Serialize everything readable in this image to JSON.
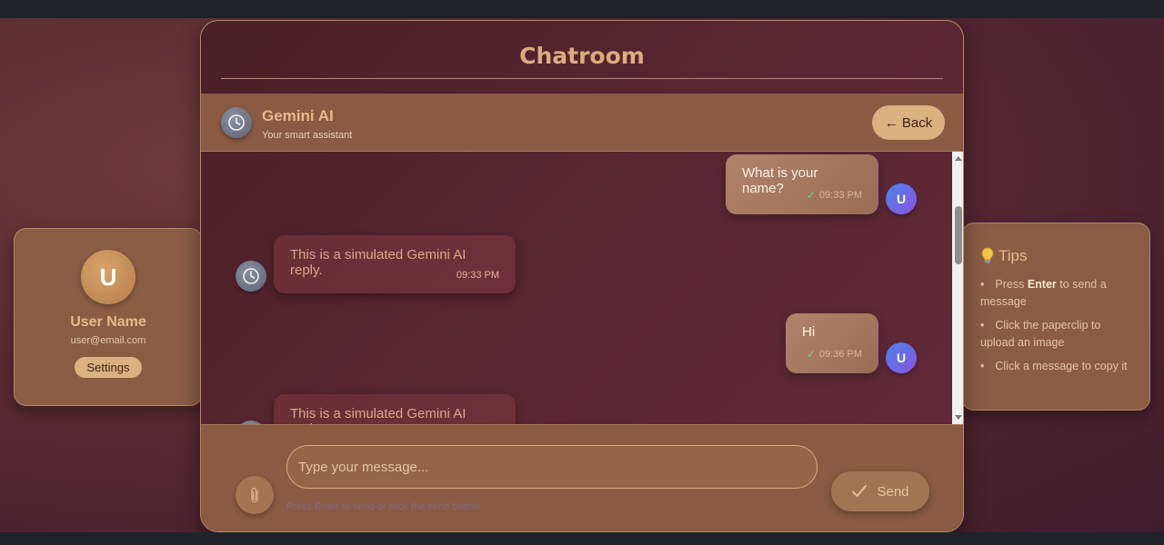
{
  "colors": {
    "accent": "#dcab80",
    "panel": "#8a5a42",
    "user_avatar_gradient": [
      "#4a84e8",
      "#8a52e0"
    ],
    "check": "#7fd27f"
  },
  "profile": {
    "avatar_letter": "U",
    "name": "User Name",
    "email": "user@email.com",
    "settings_label": "Settings"
  },
  "tips": {
    "icon": "lightbulb-icon",
    "title": "Tips",
    "items": [
      {
        "prefix": "Press ",
        "bold": "Enter",
        "suffix": " to send a message"
      },
      {
        "prefix": "Click the paperclip to upload an image",
        "bold": "",
        "suffix": ""
      },
      {
        "prefix": "Click a message to copy it",
        "bold": "",
        "suffix": ""
      }
    ]
  },
  "chat": {
    "title": "Chatroom",
    "contact": {
      "name": "Gemini AI",
      "subtitle": "Your smart assistant",
      "avatar_icon": "clock-icon"
    },
    "back_label": "← Back",
    "messages": [
      {
        "from": "user",
        "text": "What is your name?",
        "time": "09:33 PM",
        "status_icon": "check-icon",
        "avatar_letter": "U"
      },
      {
        "from": "bot",
        "text": "This is a simulated Gemini AI reply.",
        "time": "09:33 PM"
      },
      {
        "from": "user",
        "text": "Hi",
        "time": "09:36 PM",
        "status_icon": "check-icon",
        "avatar_letter": "U"
      },
      {
        "from": "bot",
        "text": "This is a simulated Gemini AI reply.",
        "time": ""
      }
    ],
    "input": {
      "placeholder": "Type your message...",
      "value": "",
      "hint": "Press Enter to send or click the send button",
      "attach_icon": "paperclip-icon"
    },
    "send_label": "Send",
    "send_icon": "checkmark-icon"
  }
}
